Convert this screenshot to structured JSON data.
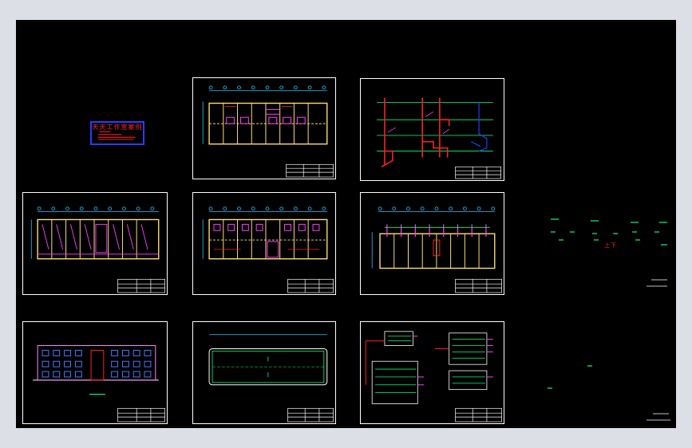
{
  "drawing": {
    "cover_title": "天天工作室案例",
    "stair_label_1": "上",
    "stair_label_2": "下"
  },
  "colors": {
    "background": "#000000",
    "frame": "#ffffff",
    "axis": "#28c8ff",
    "wall": "#ffe070",
    "pipe": "#ff40ff",
    "red": "#ff2020",
    "green": "#00ff80",
    "blue": "#2a3cff"
  }
}
